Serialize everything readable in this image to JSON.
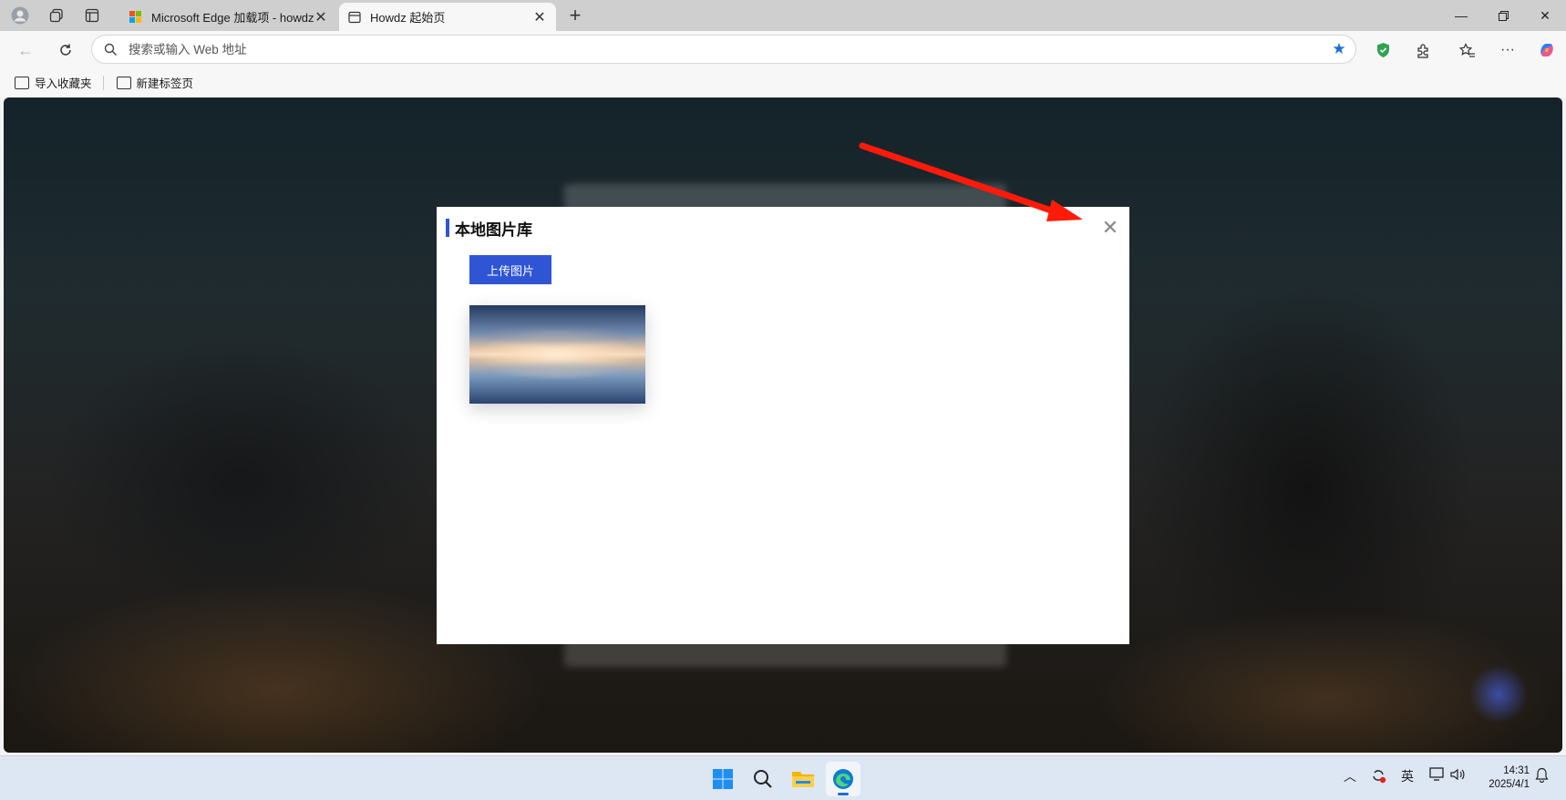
{
  "browser": {
    "tabs": [
      {
        "title": "Microsoft Edge 加载项 - howdz起",
        "favicon": "microsoft-logo-icon",
        "active": false
      },
      {
        "title": "Howdz 起始页",
        "favicon": "page-icon",
        "active": true
      }
    ],
    "address_bar": {
      "placeholder": "搜索或输入 Web 地址",
      "value": ""
    },
    "favorites": [
      {
        "label": "导入收藏夹",
        "icon": "import-favorites-icon"
      },
      {
        "label": "新建标签页",
        "icon": "new-tab-page-icon"
      }
    ],
    "colors": {
      "accent": "#1a6fd6",
      "titlebar": "#cfcfcf"
    }
  },
  "modal": {
    "title": "本地图片库",
    "upload_label": "上传图片",
    "close_icon": "close-icon",
    "images": [
      {
        "thumbnail": "sky-reflection-landscape"
      }
    ],
    "accent_color": "#2f55d4"
  },
  "annotation": {
    "type": "red-arrow",
    "points_to": "modal-close-button",
    "color": "#ff1a0a"
  },
  "taskbar": {
    "apps": [
      "windows-start-icon",
      "search-icon",
      "file-explorer-icon",
      "edge-icon"
    ],
    "tray": {
      "input_method": "英",
      "time": "14:31",
      "date": "2025/4/1"
    }
  }
}
